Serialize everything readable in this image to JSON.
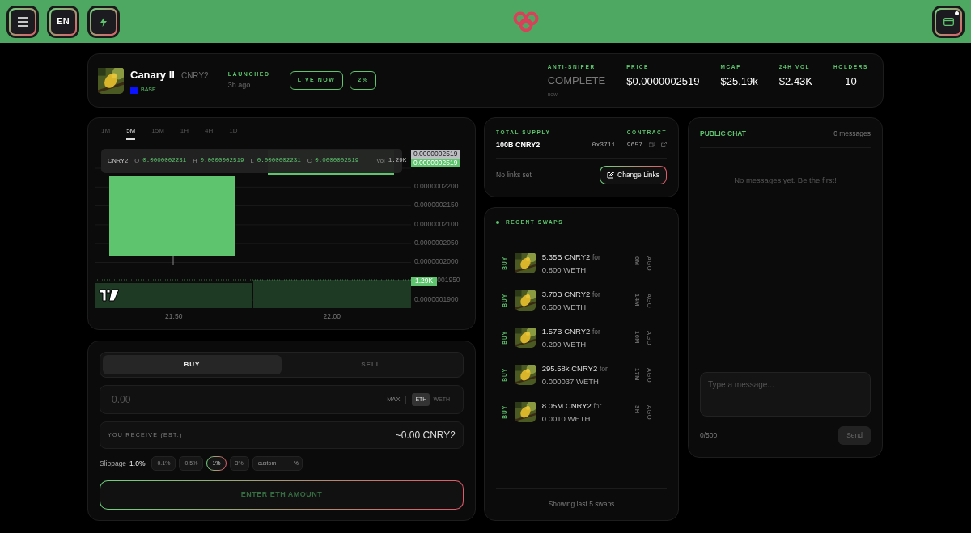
{
  "header": {
    "buttons": [
      {
        "kind": "menu"
      },
      {
        "kind": "text",
        "label": "EN"
      },
      {
        "kind": "bolt"
      }
    ],
    "wallet": {
      "notification": true
    }
  },
  "token": {
    "name": "Canary II",
    "ticker": "CNRY2",
    "chain": "BASE",
    "launched_label": "LAUNCHED",
    "launched_value": "3h ago",
    "badges": [
      "LIVE NOW",
      "2%"
    ],
    "stats": [
      {
        "kind": "status",
        "label": "ANTI-SNIPER",
        "value": "COMPLETE",
        "note": "now"
      },
      {
        "kind": "value",
        "label": "PRICE",
        "value": "$0.0000002519"
      },
      {
        "kind": "value",
        "label": "MCAP",
        "value": "$25.19k"
      },
      {
        "kind": "value",
        "label": "24H VOL",
        "value": "$2.43K"
      },
      {
        "kind": "value",
        "label": "HOLDERS",
        "value": "10"
      }
    ]
  },
  "chart": {
    "timeframes": [
      {
        "label": "1M",
        "selected": false
      },
      {
        "label": "5M",
        "selected": true
      },
      {
        "label": "15M",
        "selected": false
      },
      {
        "label": "1H",
        "selected": false
      },
      {
        "label": "4H",
        "selected": false
      },
      {
        "label": "1D",
        "selected": false
      }
    ],
    "legend": {
      "symbol": "CNRY2",
      "fields": [
        {
          "label": "O",
          "value": "0.0000002231"
        },
        {
          "label": "H",
          "value": "0.0000002519"
        },
        {
          "label": "L",
          "value": "0.0000002231"
        },
        {
          "label": "C",
          "value": "0.0000002519"
        },
        {
          "label": "Vol",
          "value": "1.29K"
        }
      ]
    },
    "price_tags": [
      {
        "kind": "last",
        "label": "0.0000002519"
      },
      {
        "kind": "current",
        "label": "0.0000002519"
      }
    ],
    "price_ticks": [
      "0.0000002200",
      "0.0000002150",
      "0.0000002100",
      "0.0000002050",
      "0.0000002000"
    ],
    "volume_tag": "1.29K",
    "volume_tick_rest": "001950",
    "bottom_tick": "0.0000001900",
    "time_labels": [
      "21:50",
      "22:00"
    ]
  },
  "trade": {
    "tabs": [
      {
        "label": "BUY",
        "selected": true
      },
      {
        "label": "SELL",
        "selected": false
      }
    ],
    "amount": {
      "placeholder": "0.00",
      "max": "MAX",
      "currencies": [
        {
          "label": "ETH",
          "selected": true
        },
        {
          "label": "WETH",
          "selected": false
        }
      ]
    },
    "receive": {
      "label": "YOU RECEIVE (EST.)",
      "value": "~0.00 CNRY2"
    },
    "slippage": {
      "label": "Slippage",
      "value": "1.0%",
      "options": [
        {
          "label": "0.1%",
          "selected": false
        },
        {
          "label": "0.5%",
          "selected": false
        },
        {
          "label": "1%",
          "selected": true
        },
        {
          "label": "3%",
          "selected": false
        }
      ],
      "custom_placeholder": "custom",
      "custom_suffix": "%"
    },
    "submit": "ENTER ETH AMOUNT"
  },
  "info": {
    "supply_label": "TOTAL SUPPLY",
    "supply_value": "100B CNRY2",
    "contract_label": "CONTRACT",
    "contract_value": "0x3711...9657",
    "links_text": "No links set",
    "change_links": "Change Links"
  },
  "swaps": {
    "title": "RECENT SWAPS",
    "items": [
      {
        "side": "BUY",
        "amount": "5.35B CNRY2",
        "joiner": "for",
        "paid": "0.800 WETH",
        "age": "6M",
        "ago": "AGO"
      },
      {
        "side": "BUY",
        "amount": "3.70B CNRY2",
        "joiner": "for",
        "paid": "0.500 WETH",
        "age": "14M",
        "ago": "AGO"
      },
      {
        "side": "BUY",
        "amount": "1.57B CNRY2",
        "joiner": "for",
        "paid": "0.200 WETH",
        "age": "16M",
        "ago": "AGO"
      },
      {
        "side": "BUY",
        "amount": "295.58k CNRY2",
        "joiner": "for",
        "paid": "0.000037 WETH",
        "age": "17M",
        "ago": "AGO"
      },
      {
        "side": "BUY",
        "amount": "8.05M CNRY2",
        "joiner": "for",
        "paid": "0.0010 WETH",
        "age": "3H",
        "ago": "AGO"
      }
    ],
    "footer": "Showing last 5 swaps"
  },
  "chat": {
    "title": "PUBLIC CHAT",
    "count": "0 messages",
    "empty": "No messages yet. Be the first!",
    "placeholder": "Type a message...",
    "counter": "0/500",
    "send": "Send"
  }
}
